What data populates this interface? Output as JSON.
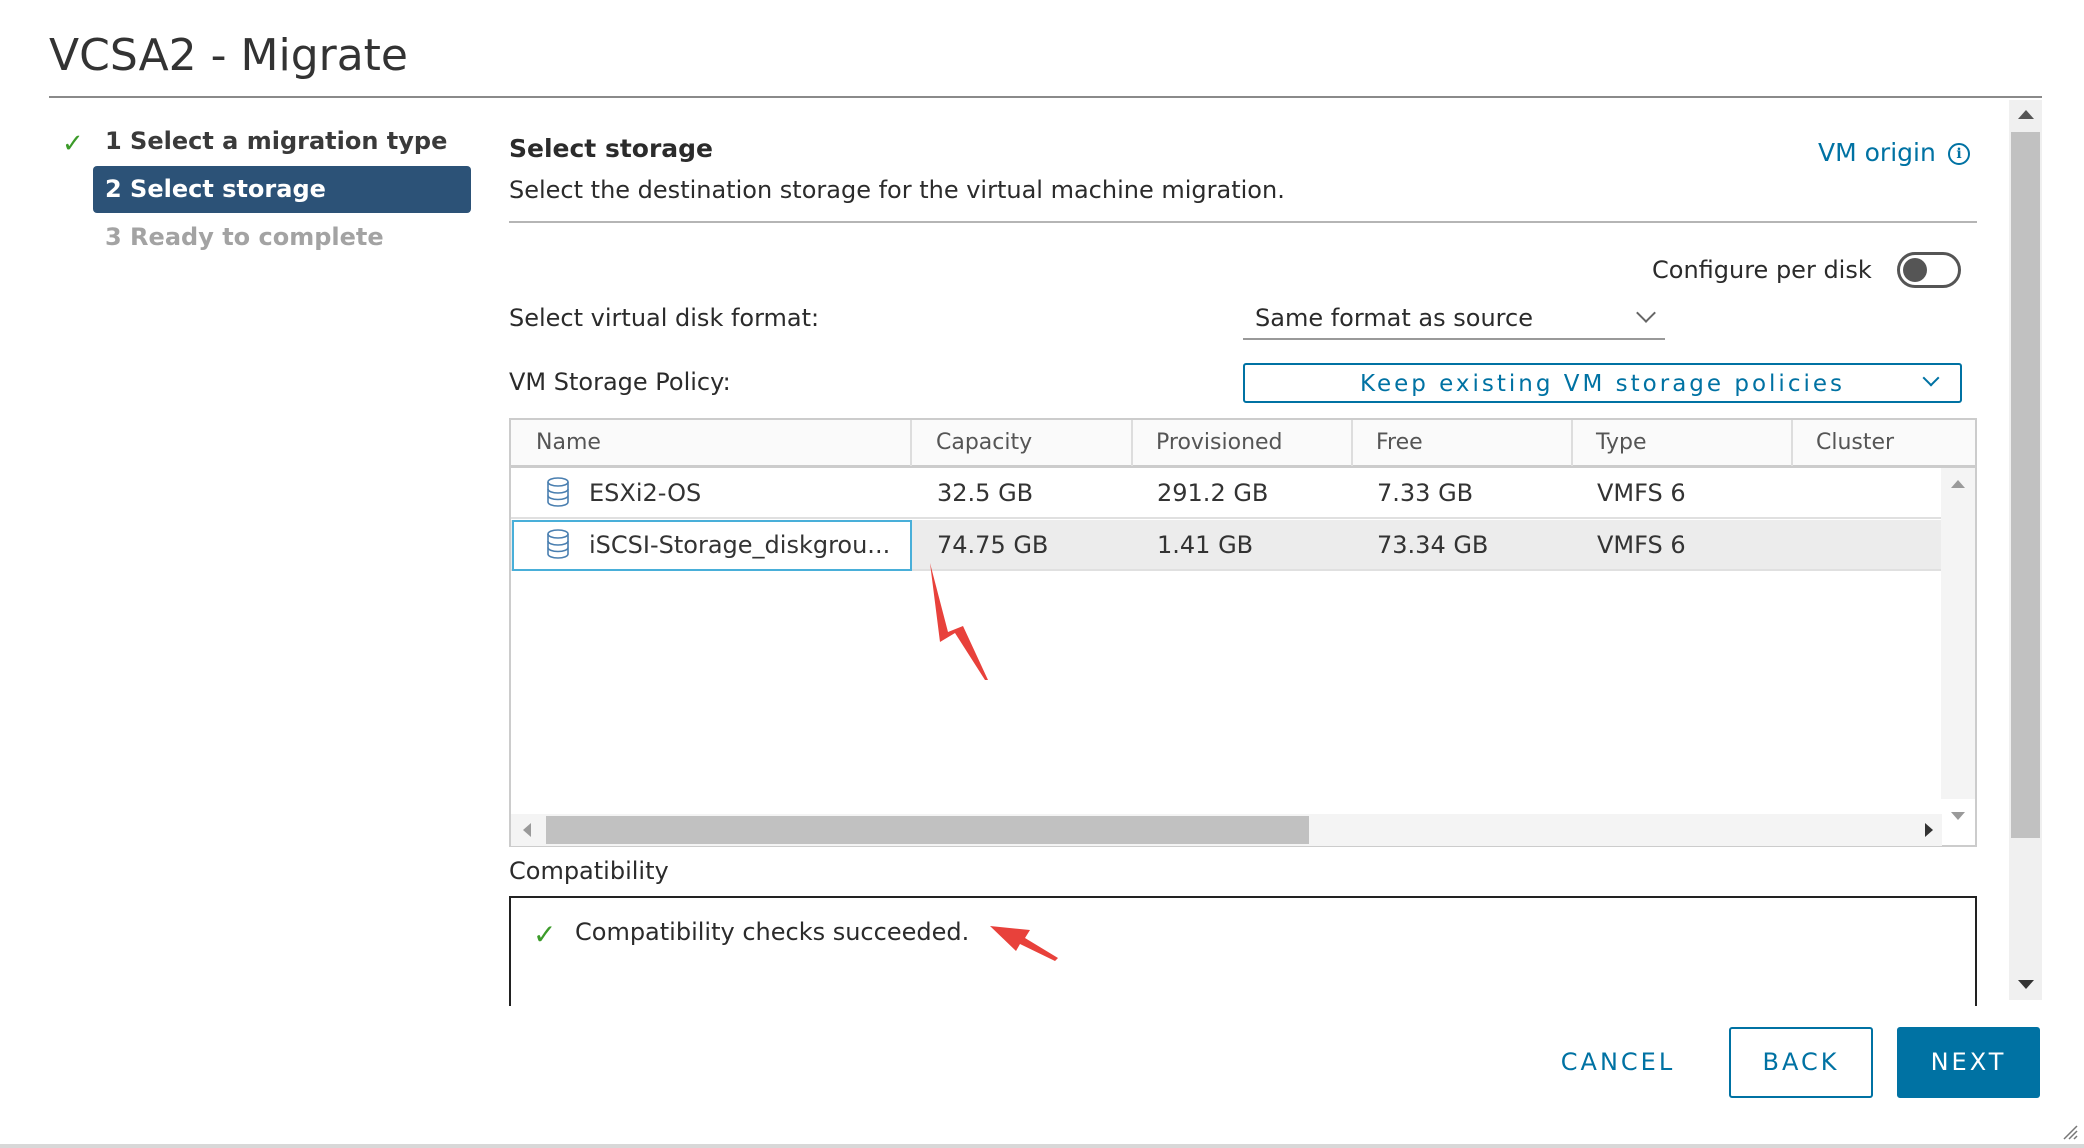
{
  "dialog": {
    "title": "VCSA2 - Migrate"
  },
  "steps": [
    {
      "label": "1 Select a migration type",
      "state": "completed"
    },
    {
      "label": "2 Select storage",
      "state": "active"
    },
    {
      "label": "3 Ready to complete",
      "state": "disabled"
    }
  ],
  "section": {
    "title": "Select storage",
    "description": "Select the destination storage for the virtual machine migration.",
    "vm_origin_link": "VM origin"
  },
  "options": {
    "configure_per_disk_label": "Configure per disk",
    "configure_per_disk_on": false,
    "disk_format_label": "Select virtual disk format:",
    "disk_format_value": "Same format as source",
    "storage_policy_label": "VM Storage Policy:",
    "storage_policy_value": "Keep existing VM storage policies"
  },
  "datastore_table": {
    "columns": [
      "Name",
      "Capacity",
      "Provisioned",
      "Free",
      "Type",
      "Cluster"
    ],
    "rows": [
      {
        "name": "ESXi2-OS",
        "capacity": "32.5 GB",
        "provisioned": "291.2 GB",
        "free": "7.33 GB",
        "type": "VMFS 6",
        "cluster": "",
        "selected": false
      },
      {
        "name": "iSCSI-Storage_diskgrou...",
        "capacity": "74.75 GB",
        "provisioned": "1.41 GB",
        "free": "73.34 GB",
        "type": "VMFS 6",
        "cluster": "",
        "selected": true
      }
    ]
  },
  "compatibility": {
    "label": "Compatibility",
    "message": "Compatibility checks succeeded."
  },
  "footer": {
    "cancel_label": "CANCEL",
    "back_label": "BACK",
    "next_label": "NEXT"
  },
  "colors": {
    "accent": "#0072a3",
    "active_step_bg": "#2c5277",
    "success": "#3c9b2a",
    "annotation": "#e8413b"
  },
  "icons": {
    "step_done": "check-icon",
    "datastore": "database-icon",
    "info": "info-circle-icon",
    "dropdown": "chevron-down-icon"
  }
}
